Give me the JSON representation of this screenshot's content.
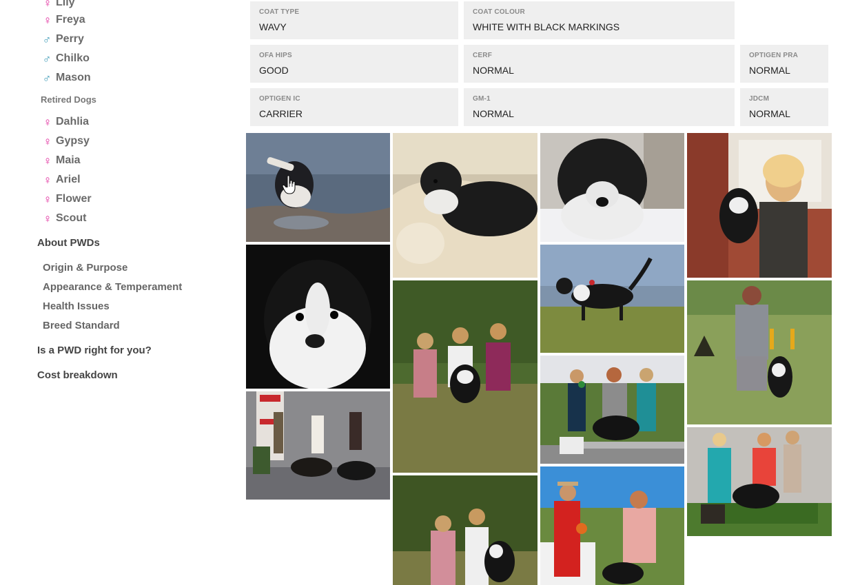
{
  "sidebar": {
    "active_dogs": [
      {
        "name": "Lily",
        "sex": "female"
      },
      {
        "name": "Freya",
        "sex": "female"
      },
      {
        "name": "Perry",
        "sex": "male"
      },
      {
        "name": "Chilko",
        "sex": "male"
      },
      {
        "name": "Mason",
        "sex": "male"
      }
    ],
    "retired_label": "Retired Dogs",
    "retired_dogs": [
      {
        "name": "Dahlia",
        "sex": "female"
      },
      {
        "name": "Gypsy",
        "sex": "female"
      },
      {
        "name": "Maia",
        "sex": "female"
      },
      {
        "name": "Ariel",
        "sex": "female"
      },
      {
        "name": "Flower",
        "sex": "female"
      },
      {
        "name": "Scout",
        "sex": "female"
      }
    ],
    "about_label": "About PWDs",
    "about_items": [
      "Origin & Purpose",
      "Appearance & Temperament",
      "Health Issues",
      "Breed Standard"
    ],
    "pwd_right_label": "Is a PWD right for you?",
    "cost_label": "Cost breakdown",
    "female_symbol": "♀",
    "male_symbol": "♂",
    "female_color": "#e0249a",
    "male_color": "#3e9bb7"
  },
  "health": {
    "coat_type": {
      "label": "COAT TYPE",
      "value": "WAVY"
    },
    "coat_colour": {
      "label": "COAT COLOUR",
      "value": "WHITE WITH BLACK MARKINGS"
    },
    "ofa_hips": {
      "label": "OFA HIPS",
      "value": "GOOD"
    },
    "cerf": {
      "label": "CERF",
      "value": "NORMAL"
    },
    "optigen_pra": {
      "label": "OPTIGEN PRA",
      "value": "NORMAL"
    },
    "optigen_ic": {
      "label": "OPTIGEN IC",
      "value": "CARRIER"
    },
    "gm1": {
      "label": "GM-1",
      "value": "NORMAL"
    },
    "jdcm": {
      "label": "JDCM",
      "value": "NORMAL"
    }
  },
  "gallery": {
    "photos": [
      "dog-swimming-with-toy",
      "dog-on-cream-chair",
      "curly-dog-closeup-in-snow",
      "woman-holding-puppy",
      "black-white-puppy-closeup",
      "dog-trotting-by-water",
      "three-women-with-dog-on-grass",
      "show-ring-group-with-dogs",
      "show-stack-with-ribbons",
      "handler-running-with-dog",
      "women-with-dog-outdoors",
      "judge-in-red-jacket",
      "show-table-with-trophy"
    ]
  }
}
